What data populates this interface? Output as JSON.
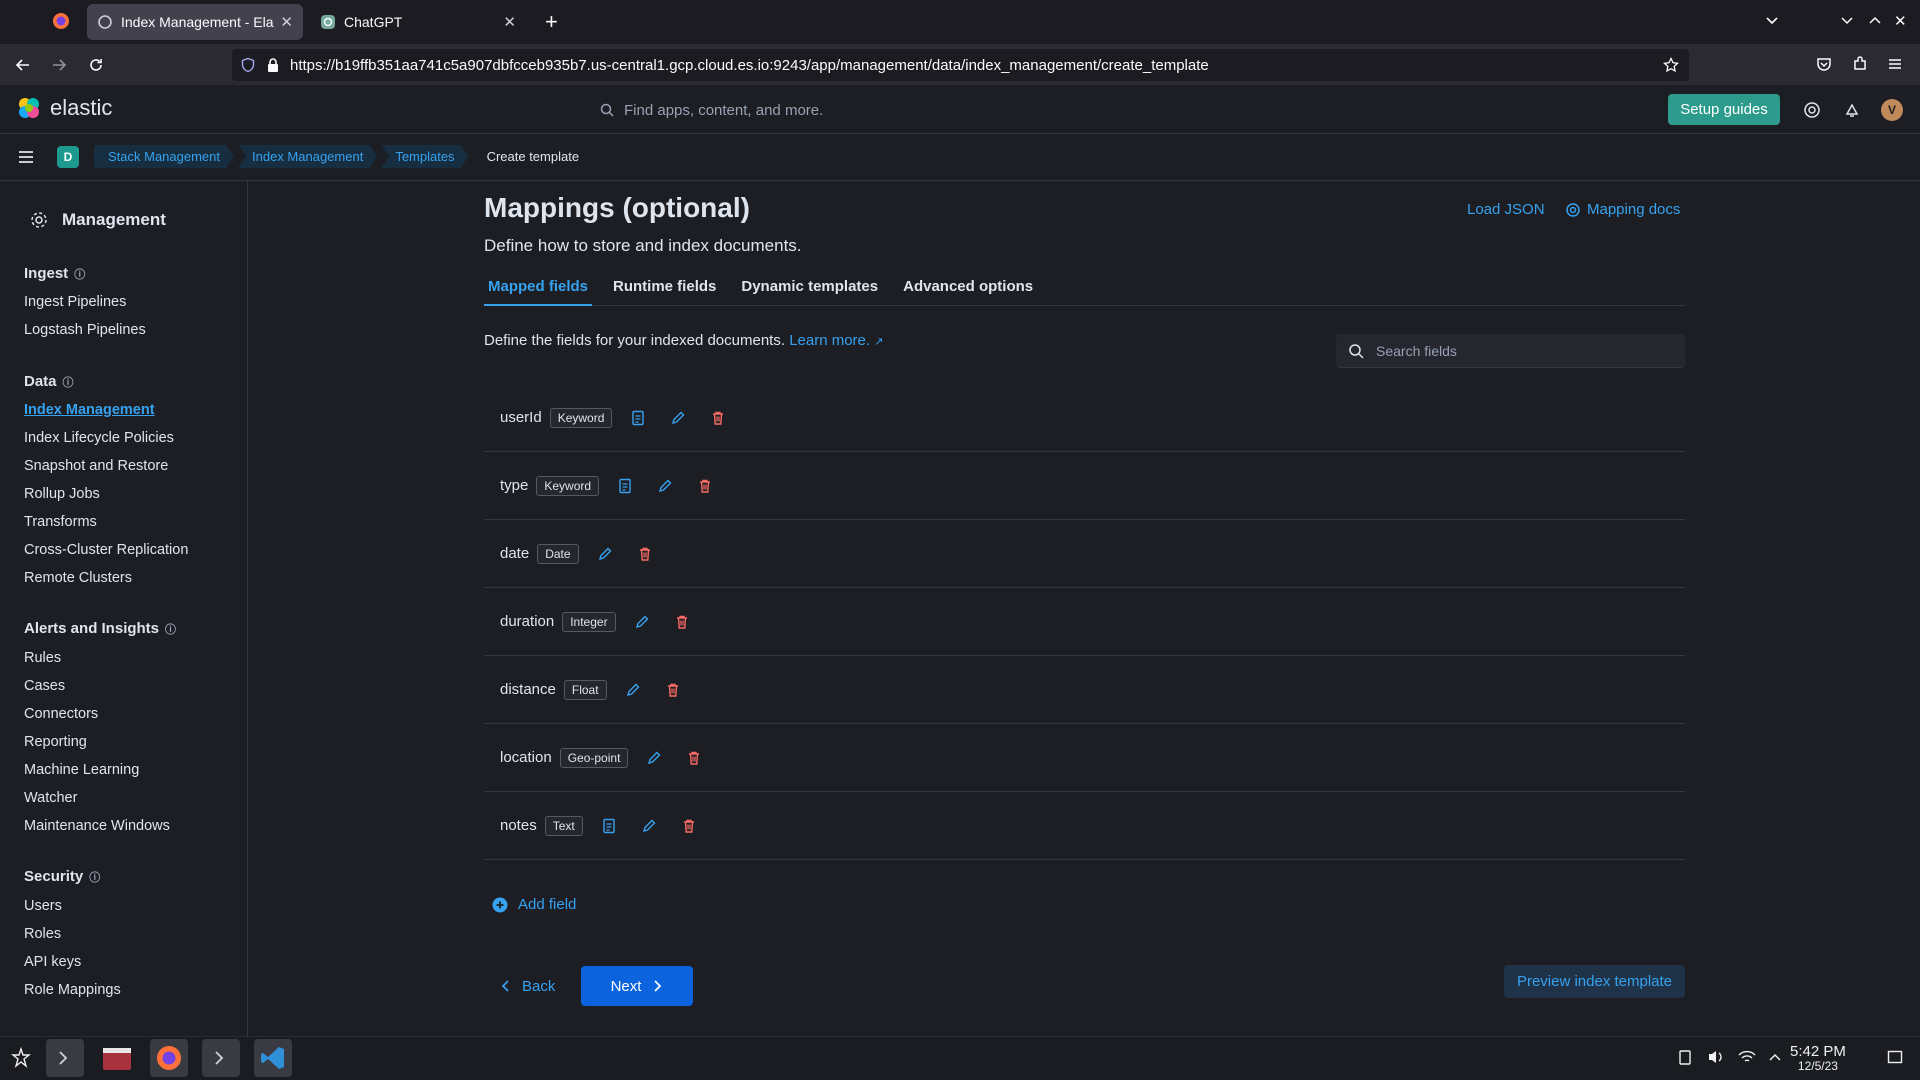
{
  "browser": {
    "tabs": [
      {
        "title": "Index Management - Elastic",
        "active": true
      },
      {
        "title": "ChatGPT",
        "active": false
      }
    ],
    "url": "https://b19ffb351aa741c5a907dbfcceb935b7.us-central1.gcp.cloud.es.io:9243/app/management/data/index_management/create_template"
  },
  "header": {
    "logo_text": "elastic",
    "search_placeholder": "Find apps, content, and more.",
    "setup_guides": "Setup guides",
    "avatar_letter": "V",
    "space_letter": "D"
  },
  "breadcrumbs": [
    "Stack Management",
    "Index Management",
    "Templates",
    "Create template"
  ],
  "sidebar": {
    "title": "Management",
    "groups": [
      {
        "label": "Ingest",
        "items": [
          "Ingest Pipelines",
          "Logstash Pipelines"
        ]
      },
      {
        "label": "Data",
        "items": [
          "Index Management",
          "Index Lifecycle Policies",
          "Snapshot and Restore",
          "Rollup Jobs",
          "Transforms",
          "Cross-Cluster Replication",
          "Remote Clusters"
        ]
      },
      {
        "label": "Alerts and Insights",
        "items": [
          "Rules",
          "Cases",
          "Connectors",
          "Reporting",
          "Machine Learning",
          "Watcher",
          "Maintenance Windows"
        ]
      },
      {
        "label": "Security",
        "items": [
          "Users",
          "Roles",
          "API keys",
          "Role Mappings"
        ]
      }
    ],
    "active_item": "Index Management"
  },
  "main": {
    "title": "Mappings (optional)",
    "subtitle": "Define how to store and index documents.",
    "load_json": "Load JSON",
    "mapping_docs": "Mapping docs",
    "tabs": [
      "Mapped fields",
      "Runtime fields",
      "Dynamic templates",
      "Advanced options"
    ],
    "active_tab": "Mapped fields",
    "description": "Define the fields for your indexed documents.",
    "learn_more": "Learn more.",
    "search_placeholder": "Search fields",
    "fields": [
      {
        "name": "userId",
        "type": "Keyword",
        "has_doc_icon": true
      },
      {
        "name": "type",
        "type": "Keyword",
        "has_doc_icon": true
      },
      {
        "name": "date",
        "type": "Date",
        "has_doc_icon": false
      },
      {
        "name": "duration",
        "type": "Integer",
        "has_doc_icon": false
      },
      {
        "name": "distance",
        "type": "Float",
        "has_doc_icon": false
      },
      {
        "name": "location",
        "type": "Geo-point",
        "has_doc_icon": false
      },
      {
        "name": "notes",
        "type": "Text",
        "has_doc_icon": true
      }
    ],
    "add_field": "Add field",
    "back": "Back",
    "next": "Next",
    "preview": "Preview index template"
  },
  "taskbar": {
    "time": "5:42 PM",
    "date": "12/5/23"
  },
  "colors": {
    "accent": "#36a2ef",
    "primary_button": "#0b64dd",
    "setup_button": "#2d9b8b",
    "delete_icon": "#f86b63",
    "background": "#1d1e24"
  }
}
